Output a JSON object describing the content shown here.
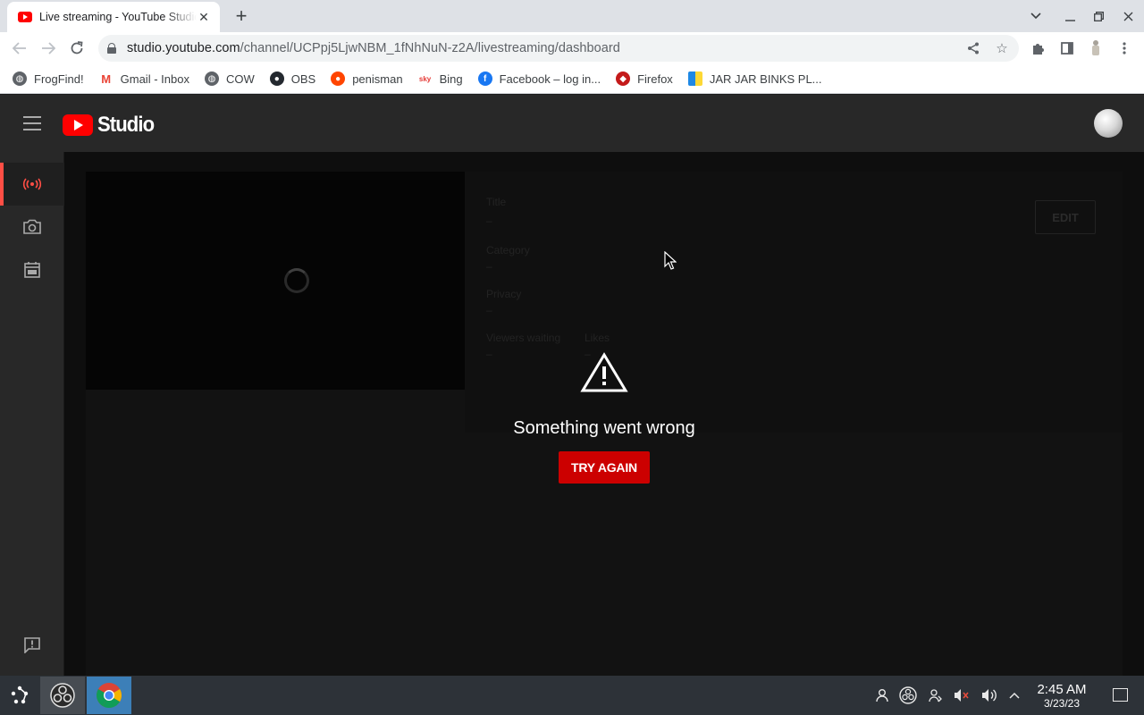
{
  "browser": {
    "tab": {
      "title": "Live streaming - YouTube Studio"
    },
    "omnibox": {
      "url_host": "studio.youtube.com",
      "url_path": "/channel/UCPpj5LjwNBM_1fNhNuN-z2A/livestreaming/dashboard"
    },
    "bookmarks": [
      {
        "label": "FrogFind!",
        "icon": "globe-icon"
      },
      {
        "label": "Gmail - Inbox",
        "icon": "gmail-icon"
      },
      {
        "label": "COW",
        "icon": "globe-icon"
      },
      {
        "label": "OBS",
        "icon": "github-icon"
      },
      {
        "label": "penisman",
        "icon": "reddit-icon"
      },
      {
        "label": "Bing",
        "icon": "bing-icon"
      },
      {
        "label": "Facebook – log in...",
        "icon": "facebook-icon"
      },
      {
        "label": "Firefox",
        "icon": "firefox-icon"
      },
      {
        "label": "JAR JAR BINKS PL...",
        "icon": "bag-icon"
      }
    ]
  },
  "studio": {
    "logo_text": "Studio",
    "sidebar": [
      {
        "name": "live-icon",
        "active": true
      },
      {
        "name": "camera-icon",
        "active": false
      },
      {
        "name": "calendar-icon",
        "active": false
      }
    ],
    "dashboard": {
      "title_label": "Title",
      "title_value": "–",
      "category_label": "Category",
      "category_value": "–",
      "privacy_label": "Privacy",
      "privacy_value": "–",
      "viewers_label": "Viewers waiting",
      "viewers_value": "–",
      "likes_label": "Likes",
      "likes_value": "–",
      "edit_label": "EDIT"
    },
    "error": {
      "message": "Something went wrong",
      "button": "TRY AGAIN"
    },
    "colors": {
      "accent": "#cc0000",
      "active_marker": "#ff4e45",
      "bg": "#1f1f1f"
    }
  },
  "taskbar": {
    "time": "2:45 AM",
    "date": "3/23/23"
  }
}
